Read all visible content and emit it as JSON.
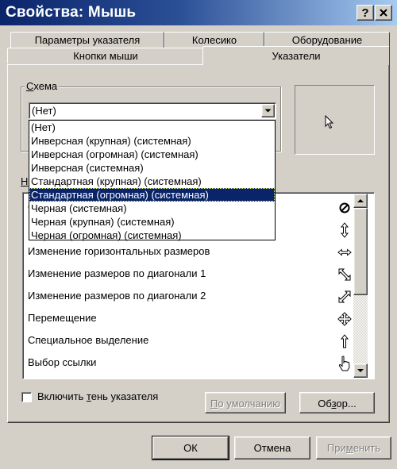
{
  "window": {
    "title": "Свойства: Мышь",
    "help_button": "?",
    "close_button": "X"
  },
  "tabs": {
    "row1": [
      "Параметры указателя",
      "Колесико",
      "Оборудование"
    ],
    "row2": [
      "Кнопки мыши",
      "Указатели"
    ],
    "active": "Указатели"
  },
  "scheme": {
    "label_prefix": "",
    "label_accel": "С",
    "label_rest": "хема",
    "selected": "(Нет)",
    "dropdown_items": [
      "(Нет)",
      "Инверсная (крупная) (системная)",
      "Инверсная (огромная) (системная)",
      "Инверсная (системная)",
      "Стандартная (крупная) (системная)",
      "Стандартная (огромная) (системная)",
      "Черная  (системная)",
      "Черная (крупная) (системная)",
      "Черная (огромная) (системная)"
    ],
    "highlighted_index": 5
  },
  "customize_label_visible": "Н",
  "pointer_list": {
    "rows": [
      {
        "label": "О",
        "icon": "unavailable-icon"
      },
      {
        "label": "И",
        "icon": "vertical-resize-icon"
      },
      {
        "label": "Изменение горизонтальных размеров",
        "icon": "horizontal-resize-icon"
      },
      {
        "label": "Изменение размеров по диагонали 1",
        "icon": "diagonal-resize-1-icon"
      },
      {
        "label": "Изменение размеров по диагонали 2",
        "icon": "diagonal-resize-2-icon"
      },
      {
        "label": "Перемещение",
        "icon": "move-icon"
      },
      {
        "label": "Специальное выделение",
        "icon": "alternate-select-icon"
      },
      {
        "label": "Выбор ссылки",
        "icon": "link-select-icon"
      }
    ]
  },
  "shadow_checkbox": {
    "pre": "Включить ",
    "accel": "т",
    "post": "ень указателя",
    "checked": false
  },
  "buttons": {
    "default_pre": "",
    "default_accel": "П",
    "default_post": "о умолчанию",
    "browse_pre": "Об",
    "browse_accel": "з",
    "browse_post": "ор...",
    "ok": "ОК",
    "cancel": "Отмена",
    "apply_pre": "При",
    "apply_accel": "м",
    "apply_post": "енить"
  }
}
